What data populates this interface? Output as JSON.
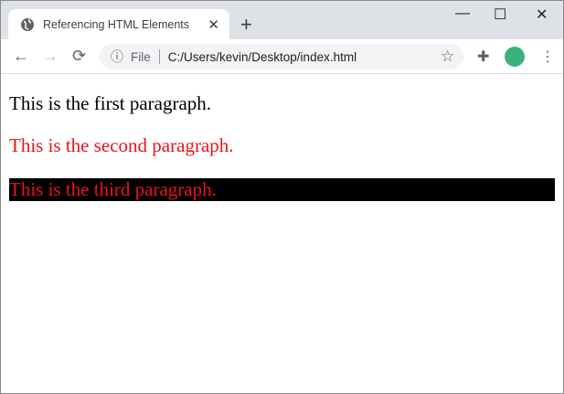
{
  "tab": {
    "title": "Referencing HTML Elements",
    "close": "✕",
    "new_tab": "+"
  },
  "window_controls": {
    "minimize": "—",
    "maximize": "☐",
    "close": "✕"
  },
  "toolbar": {
    "scheme": "File",
    "url": "C:/Users/kevin/Desktop/index.html"
  },
  "page": {
    "paragraphs": [
      "This is the first paragraph.",
      "This is the second paragraph.",
      "This is the third paragraph."
    ]
  },
  "colors": {
    "accent_red": "#e8141c",
    "highlight_bg": "#000000"
  }
}
